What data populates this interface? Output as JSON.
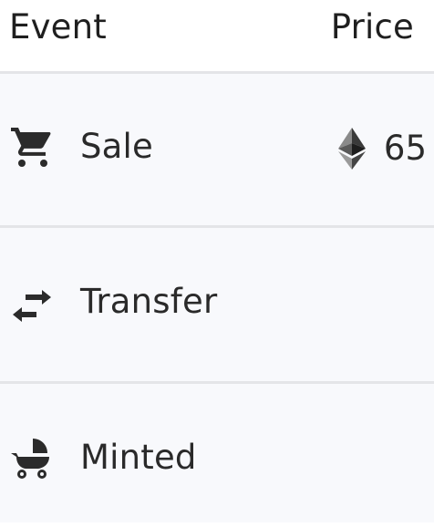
{
  "header": {
    "event_label": "Event",
    "price_label": "Price"
  },
  "rows": [
    {
      "icon": "shopping-cart-icon",
      "label": "Sale",
      "price": "65",
      "currency_icon": "ethereum-icon"
    },
    {
      "icon": "transfer-arrows-icon",
      "label": "Transfer",
      "price": ""
    },
    {
      "icon": "baby-carriage-icon",
      "label": "Minted",
      "price": ""
    }
  ],
  "colors": {
    "header_bg": "#ffffff",
    "row_bg": "#f8f9fc",
    "divider": "#e4e5e8",
    "text": "#2a2a2a",
    "icon": "#2b2b2b"
  }
}
